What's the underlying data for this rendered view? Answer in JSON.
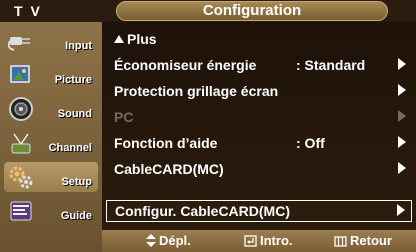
{
  "header": {
    "tv_label": "T V",
    "title": "Configuration"
  },
  "sidebar": {
    "items": [
      {
        "label": "Input",
        "icon": "input-plug-icon"
      },
      {
        "label": "Picture",
        "icon": "picture-icon"
      },
      {
        "label": "Sound",
        "icon": "sound-speaker-icon"
      },
      {
        "label": "Channel",
        "icon": "channel-antenna-icon"
      },
      {
        "label": "Setup",
        "icon": "setup-gears-icon"
      },
      {
        "label": "Guide",
        "icon": "guide-program-icon"
      }
    ],
    "active_index": 4
  },
  "menu": {
    "more_label": "Plus",
    "items": [
      {
        "label": "Économiseur énergie",
        "value": ": Standard",
        "state": "normal"
      },
      {
        "label": "Protection grillage écran",
        "value": "",
        "state": "normal"
      },
      {
        "label": "PC",
        "value": "",
        "state": "disabled"
      },
      {
        "label": "Fonction d’aide",
        "value": ": Off",
        "state": "normal"
      },
      {
        "label": "CableCARD(MC)",
        "value": "",
        "state": "normal"
      },
      {
        "label": "Configur. CableCARD(MC)",
        "value": "",
        "state": "selected"
      }
    ]
  },
  "footer": {
    "move": "Dépl.",
    "enter": "Intro.",
    "return": "Retour"
  },
  "colors": {
    "accent": "#9a7e4e",
    "panel": "#2b1c0d"
  }
}
